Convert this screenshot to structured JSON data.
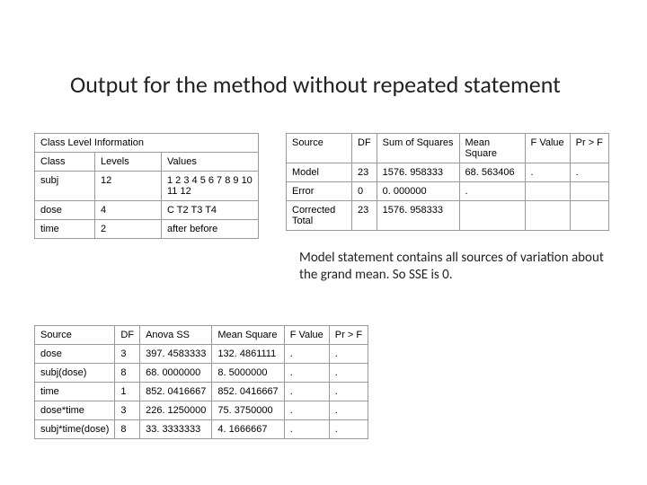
{
  "title": "Output for the method without repeated statement",
  "class_table": {
    "caption": "Class Level Information",
    "headers": {
      "class": "Class",
      "levels": "Levels",
      "values": "Values"
    },
    "rows": [
      {
        "class": "subj",
        "levels": "12",
        "values": "1 2 3 4 5 6 7 8 9 10 11 12"
      },
      {
        "class": "dose",
        "levels": "4",
        "values": "C T2 T3 T4"
      },
      {
        "class": "time",
        "levels": "2",
        "values": "after before"
      }
    ]
  },
  "anova1": {
    "headers": {
      "source": "Source",
      "df": "DF",
      "ss": "Sum of Squares",
      "ms": "Mean Square",
      "f": "F Value",
      "p": "Pr > F"
    },
    "rows": [
      {
        "source": "Model",
        "df": "23",
        "ss": "1576. 958333",
        "ms": "68. 563406",
        "f": ".",
        "p": "."
      },
      {
        "source": "Error",
        "df": "0",
        "ss": "0. 000000",
        "ms": ".",
        "f": "",
        "p": ""
      },
      {
        "source": "Corrected Total",
        "df": "23",
        "ss": "1576. 958333",
        "ms": "",
        "f": "",
        "p": ""
      }
    ]
  },
  "note": "Model statement contains all sources of variation about the grand mean.  So SSE is 0.",
  "anova2": {
    "headers": {
      "source": "Source",
      "df": "DF",
      "ss": "Anova SS",
      "ms": "Mean Square",
      "f": "F Value",
      "p": "Pr > F"
    },
    "rows": [
      {
        "source": "dose",
        "df": "3",
        "ss": "397. 4583333",
        "ms": "132. 4861111",
        "f": ".",
        "p": "."
      },
      {
        "source": "subj(dose)",
        "df": "8",
        "ss": "68. 0000000",
        "ms": "8. 5000000",
        "f": ".",
        "p": "."
      },
      {
        "source": "time",
        "df": "1",
        "ss": "852. 0416667",
        "ms": "852. 0416667",
        "f": ".",
        "p": "."
      },
      {
        "source": "dose*time",
        "df": "3",
        "ss": "226. 1250000",
        "ms": "75. 3750000",
        "f": ".",
        "p": "."
      },
      {
        "source": "subj*time(dose)",
        "df": "8",
        "ss": "33. 3333333",
        "ms": "4. 1666667",
        "f": ".",
        "p": "."
      }
    ]
  }
}
